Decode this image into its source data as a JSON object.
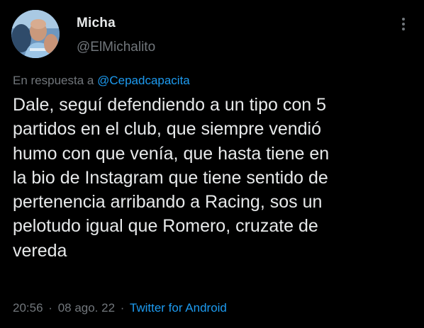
{
  "author": {
    "display_name": "Micha",
    "handle": "@ElMichalito"
  },
  "reply": {
    "prefix": "En respuesta a",
    "mention": "@Cepadcapacita"
  },
  "tweet": {
    "lines": [
      "Dale, seguí defendiendo a un tipo con 5",
      "partidos en el club, que siempre vendió",
      "humo con que venía, que hasta tiene en",
      "la bio de Instagram que tiene sentido de",
      "pertenencia arribando a Racing, sos un",
      "pelotudo igual que Romero, cruzate de",
      "vereda"
    ]
  },
  "meta": {
    "time": "20:56",
    "date": "08 ago. 22",
    "separator": "·",
    "source": "Twitter for Android"
  },
  "icons": {
    "more": "more-options-icon",
    "avatar": "profile-avatar"
  },
  "colors": {
    "background": "#000000",
    "primary_text": "#e7e9ea",
    "secondary_text": "#71767b",
    "link": "#1d9bf0"
  }
}
